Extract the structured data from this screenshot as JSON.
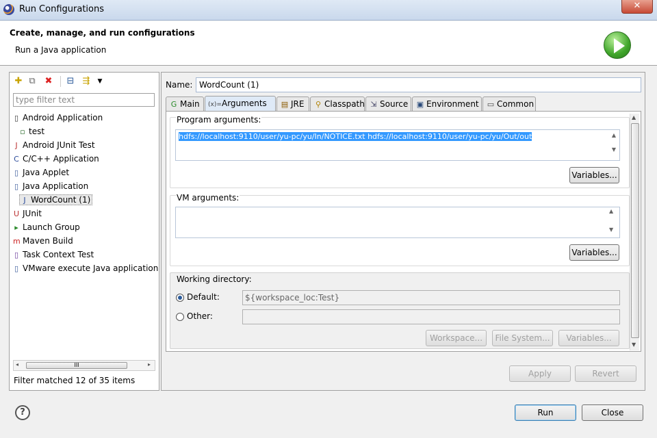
{
  "window": {
    "title": "Run Configurations",
    "close_glyph": "✕"
  },
  "header": {
    "title": "Create, manage, and run configurations",
    "subtitle": "Run a Java application"
  },
  "left": {
    "filter_placeholder": "type filter text",
    "tree": [
      {
        "label": "Android Application",
        "icon": "android-app-icon",
        "glyph": "▯",
        "level": 0
      },
      {
        "label": "test",
        "icon": "android-config-icon",
        "glyph": "▫",
        "level": 1
      },
      {
        "label": "Android JUnit Test",
        "icon": "android-junit-icon",
        "glyph": "J",
        "level": 0
      },
      {
        "label": "C/C++ Application",
        "icon": "cpp-app-icon",
        "glyph": "C",
        "level": 0
      },
      {
        "label": "Java Applet",
        "icon": "java-applet-icon",
        "glyph": "▯",
        "level": 0
      },
      {
        "label": "Java Application",
        "icon": "java-app-icon",
        "glyph": "▯",
        "level": 0
      },
      {
        "label": "WordCount (1)",
        "icon": "java-config-icon",
        "glyph": "J",
        "level": 1,
        "selected": true
      },
      {
        "label": "JUnit",
        "icon": "junit-icon",
        "glyph": "U",
        "level": 0
      },
      {
        "label": "Launch Group",
        "icon": "launch-group-icon",
        "glyph": "▸",
        "level": 0
      },
      {
        "label": "Maven Build",
        "icon": "maven-icon",
        "glyph": "m",
        "level": 0
      },
      {
        "label": "Task Context Test",
        "icon": "task-context-icon",
        "glyph": "▯",
        "level": 0
      },
      {
        "label": "VMware execute Java application",
        "icon": "vmware-icon",
        "glyph": "▯",
        "level": 0
      }
    ],
    "status": "Filter matched 12 of 35 items",
    "scroll_glyph": "III"
  },
  "right": {
    "name_label": "Name:",
    "name_value": "WordCount (1)",
    "tabs": [
      {
        "label": "Main",
        "icon": "main-tab-icon",
        "glyph": "G"
      },
      {
        "label": "Arguments",
        "icon": "arguments-tab-icon",
        "glyph": "(x)=",
        "active": true
      },
      {
        "label": "JRE",
        "icon": "jre-tab-icon",
        "glyph": "▤"
      },
      {
        "label": "Classpath",
        "icon": "classpath-tab-icon",
        "glyph": "⚲"
      },
      {
        "label": "Source",
        "icon": "source-tab-icon",
        "glyph": "⇲"
      },
      {
        "label": "Environment",
        "icon": "environment-tab-icon",
        "glyph": "▣"
      },
      {
        "label": "Common",
        "icon": "common-tab-icon",
        "glyph": "▭"
      }
    ],
    "program_args_label": "Program arguments:",
    "program_args_value": "hdfs://localhost:9110/user/yu-pc/yu/In/NOTICE.txt hdfs://localhost:9110/user/yu-pc/yu/Out/out",
    "variables_label": "Variables...",
    "vm_args_label": "VM arguments:",
    "vm_args_value": "",
    "working_dir_label": "Working directory:",
    "default_label": "Default:",
    "default_value": "${workspace_loc:Test}",
    "other_label": "Other:",
    "other_value": "",
    "workspace_btn": "Workspace...",
    "filesystem_btn": "File System...",
    "variables_btn3": "Variables...",
    "apply_btn": "Apply",
    "revert_btn": "Revert"
  },
  "footer": {
    "run_btn": "Run",
    "close_btn": "Close",
    "help_glyph": "?"
  }
}
